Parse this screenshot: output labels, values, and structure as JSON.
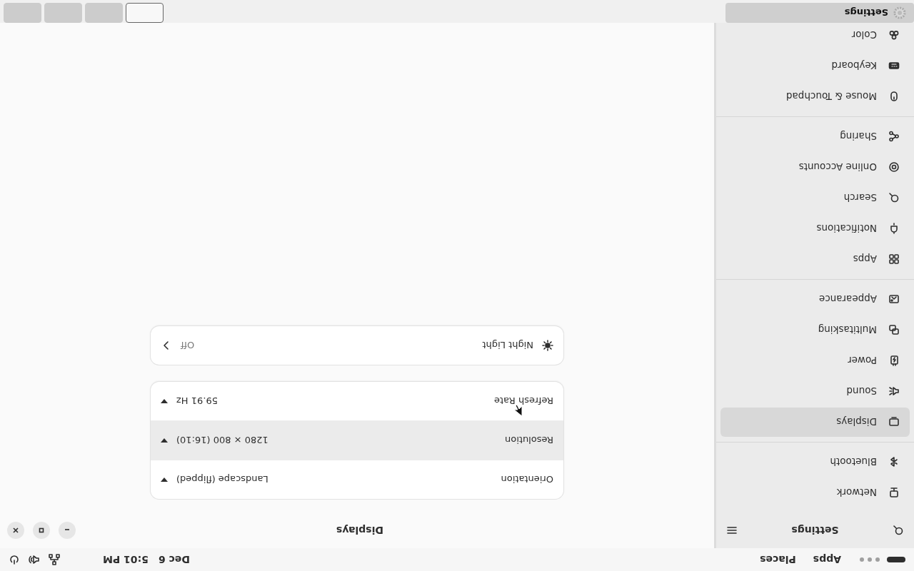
{
  "top_bar": {
    "apps": "Apps",
    "places": "Places",
    "date": "Dec 6",
    "time": "5:01 PM"
  },
  "window": {
    "sidebar": {
      "title": "Settings",
      "groups": [
        {
          "items": [
            {
              "label": "Network",
              "selected": false
            },
            {
              "label": "Bluetooth",
              "selected": false
            }
          ]
        },
        {
          "items": [
            {
              "label": "Displays",
              "selected": true
            },
            {
              "label": "Sound",
              "selected": false
            },
            {
              "label": "Power",
              "selected": false
            },
            {
              "label": "Multitasking",
              "selected": false
            },
            {
              "label": "Appearance",
              "selected": false
            }
          ]
        },
        {
          "items": [
            {
              "label": "Apps",
              "selected": false
            },
            {
              "label": "Notifications",
              "selected": false
            },
            {
              "label": "Search",
              "selected": false
            },
            {
              "label": "Online Accounts",
              "selected": false
            },
            {
              "label": "Sharing",
              "selected": false
            }
          ]
        },
        {
          "items": [
            {
              "label": "Mouse & Touchpad",
              "selected": false
            },
            {
              "label": "Keyboard",
              "selected": false
            },
            {
              "label": "Color",
              "selected": false
            }
          ]
        }
      ]
    },
    "page_title": "Displays",
    "display_settings": [
      {
        "label": "Orientation",
        "value": "Landscape (flipped)",
        "highlighted": false
      },
      {
        "label": "Resolution",
        "value": "1280 × 800 (16:10)",
        "highlighted": true
      },
      {
        "label": "Refresh Rate",
        "value": "59.91 Hz",
        "highlighted": false
      }
    ],
    "night_light": {
      "label": "Night Light",
      "value": "Off"
    }
  },
  "dock": {
    "app": {
      "label": "Settings"
    },
    "workspaces": [
      {
        "selected": true
      },
      {
        "selected": false
      },
      {
        "selected": false
      },
      {
        "selected": false
      }
    ]
  }
}
